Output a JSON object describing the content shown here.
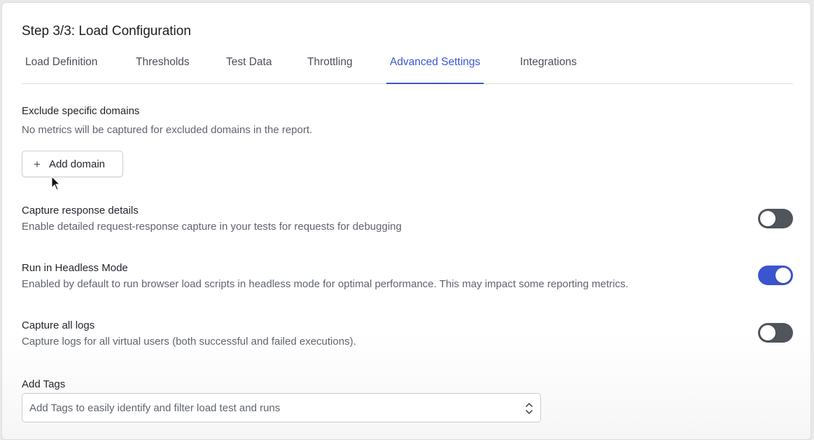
{
  "header": {
    "title": "Step 3/3: Load Configuration"
  },
  "tabs": [
    {
      "label": "Load Definition"
    },
    {
      "label": "Thresholds"
    },
    {
      "label": "Test Data"
    },
    {
      "label": "Throttling"
    },
    {
      "label": "Advanced Settings"
    },
    {
      "label": "Integrations"
    }
  ],
  "active_tab": "Advanced Settings",
  "exclude_domains": {
    "title": "Exclude specific domains",
    "description": "No metrics will be captured for excluded domains in the report.",
    "add_button_label": "Add domain"
  },
  "capture_response": {
    "title": "Capture response details",
    "description": "Enable detailed request-response capture in your tests for requests for debugging",
    "enabled": false
  },
  "headless_mode": {
    "title": "Run in Headless Mode",
    "description": "Enabled by default to run browser load scripts in headless mode for optimal performance. This may impact some reporting metrics.",
    "enabled": true
  },
  "capture_logs": {
    "title": "Capture all logs",
    "description": "Capture logs for all virtual users (both successful and failed executions).",
    "enabled": false
  },
  "tags": {
    "title": "Add Tags",
    "placeholder": "Add Tags to easily identify and filter load test and runs"
  },
  "colors": {
    "accent": "#3a55d0",
    "toggle_off": "#50545b"
  }
}
